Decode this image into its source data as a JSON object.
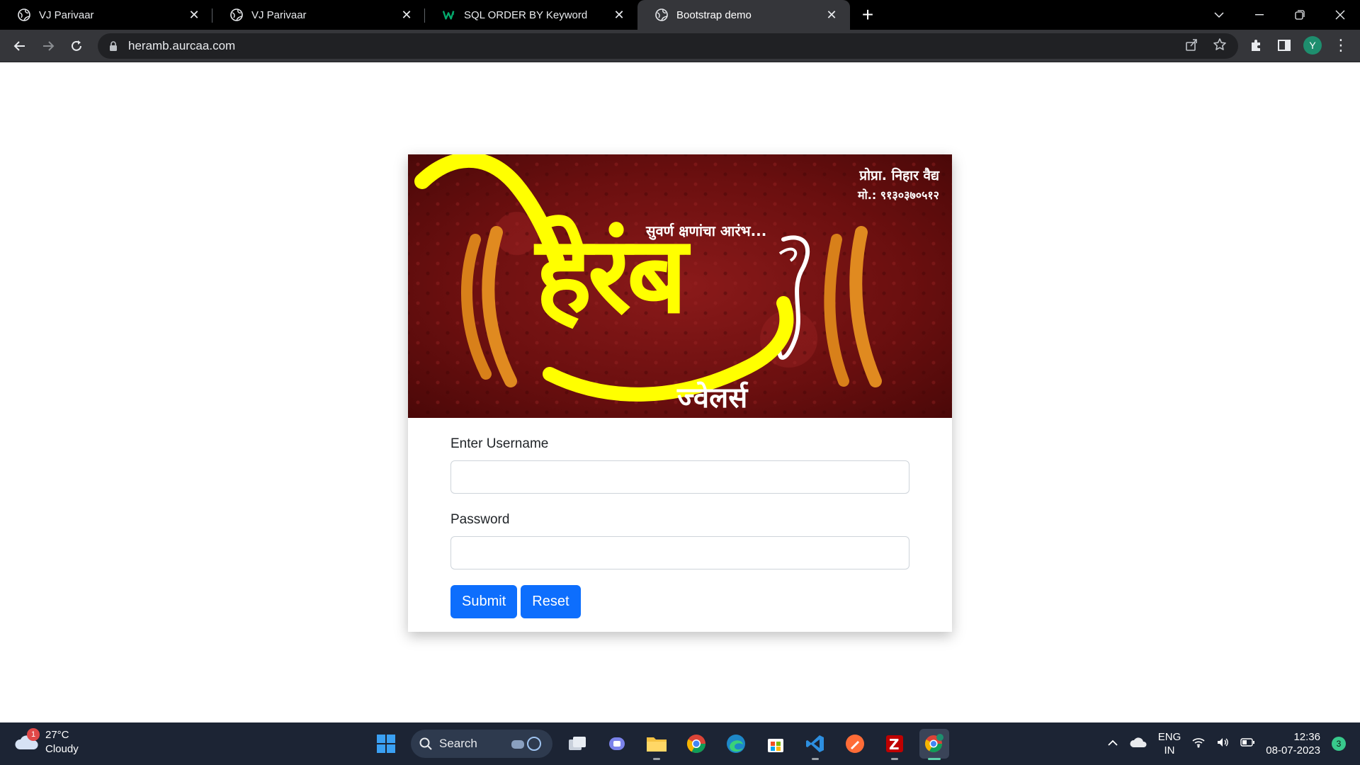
{
  "browser": {
    "tabs": [
      {
        "title": "VJ Parivaar",
        "icon": "globe-icon",
        "active": false
      },
      {
        "title": "VJ Parivaar",
        "icon": "globe-icon",
        "active": false
      },
      {
        "title": "SQL ORDER BY Keyword",
        "icon": "w3schools-icon",
        "active": false
      },
      {
        "title": "Bootstrap demo",
        "icon": "globe-icon",
        "active": true
      }
    ],
    "url": "heramb.aurcaa.com",
    "profile_initial": "Y"
  },
  "banner": {
    "owner": "प्रोप्रा. निहार वैद्य",
    "phone": "मो.: ९१३०३७०५१२",
    "tagline": "सुवर्ण क्षणांचा आरंभ...",
    "brand": "हेरंब",
    "sub": "ज्वेलर्स"
  },
  "form": {
    "username_label": "Enter Username",
    "username_value": "",
    "password_label": "Password",
    "password_value": "",
    "submit_label": "Submit",
    "reset_label": "Reset"
  },
  "taskbar": {
    "weather_temp": "27°C",
    "weather_desc": "Cloudy",
    "weather_badge": "1",
    "search_label": "Search",
    "lang_1": "ENG",
    "lang_2": "IN",
    "time": "12:36",
    "date": "08-07-2023",
    "notifications": "3"
  },
  "colors": {
    "accent": "#0d6efd",
    "brand_yellow": "#ffff00",
    "banner_red": "#7a1414"
  }
}
